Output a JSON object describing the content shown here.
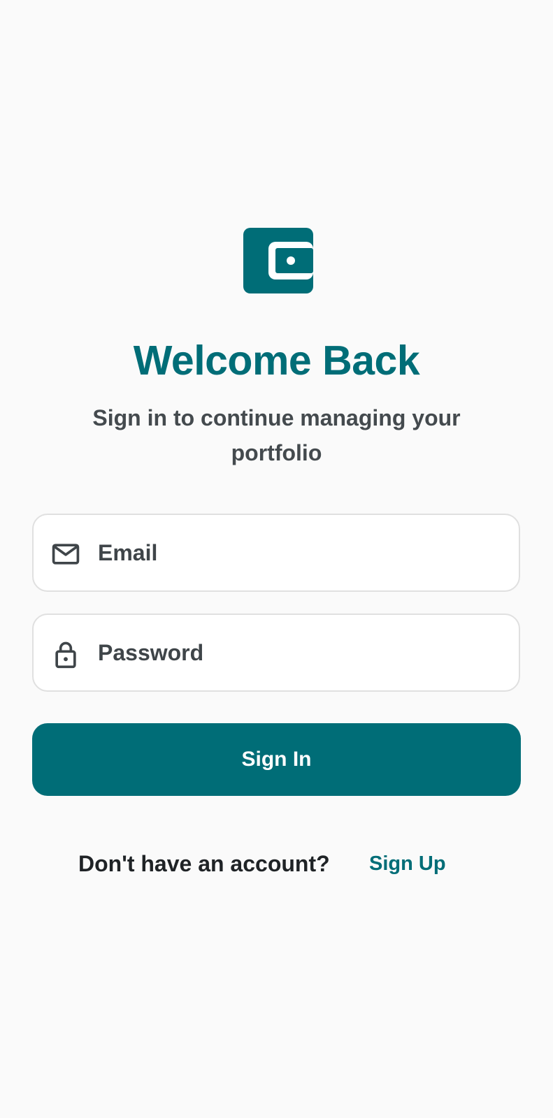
{
  "brand": {
    "logo_icon": "wallet-icon",
    "accent_color": "#006d77"
  },
  "header": {
    "title": "Welcome Back",
    "subtitle": "Sign in to continue managing your portfolio"
  },
  "form": {
    "email": {
      "icon": "mail-icon",
      "placeholder": "Email",
      "value": ""
    },
    "password": {
      "icon": "lock-icon",
      "placeholder": "Password",
      "value": ""
    },
    "submit_label": "Sign In"
  },
  "footer": {
    "prompt": "Don't have an account?",
    "signup_label": "Sign Up"
  }
}
